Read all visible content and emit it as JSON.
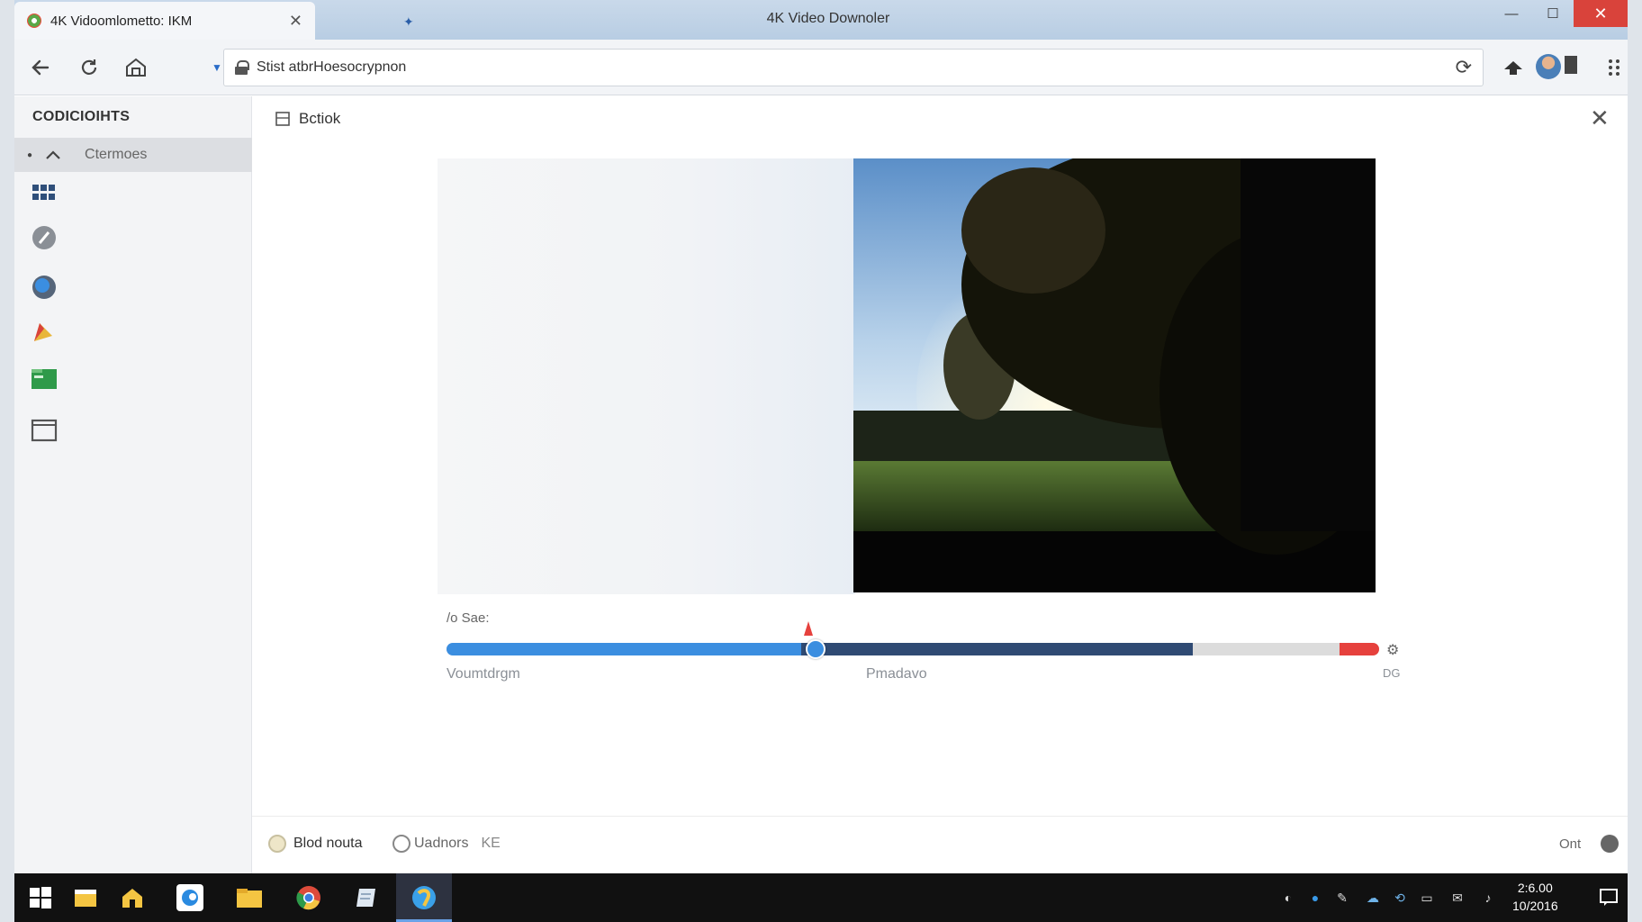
{
  "browser": {
    "tab_title": "4K Vidoomlometto: IKM",
    "window_title": "4K Video Downoler",
    "url": "Stist atbrHoesocrypnon"
  },
  "sidebar": {
    "header": "CODICIOIHTS",
    "selected_item": "Ctermoes"
  },
  "panel": {
    "title": "Bctiok",
    "progress_caption": "/o Sae:",
    "label_left": "Voumtdrgm",
    "label_mid": "Pmadavo",
    "label_right": "DG",
    "progress": {
      "played_fraction": 0.38,
      "buffered_fraction": 0.8,
      "accent": "#3b8ee0",
      "end_color": "#e6413d"
    }
  },
  "footer": {
    "option1": "Blod nouta",
    "option2": "Uadnors",
    "option2_suffix": "KE",
    "right_text": "Ont"
  },
  "taskbar": {
    "clock_time": "2:6.00",
    "clock_date": "10/2016"
  }
}
